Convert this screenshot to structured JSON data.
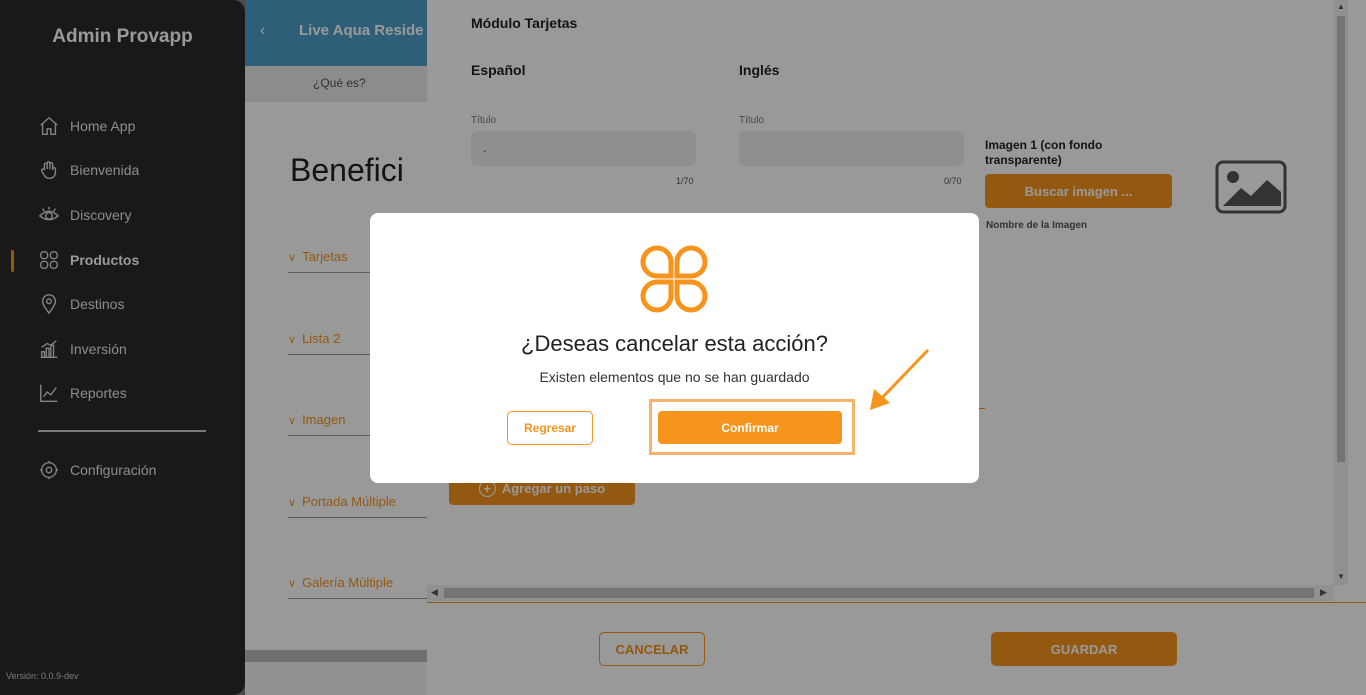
{
  "sidebar": {
    "brand": "Admin Provapp",
    "items": [
      {
        "label": "Home App",
        "icon": "home-icon"
      },
      {
        "label": "Bienvenida",
        "icon": "hand-icon"
      },
      {
        "label": "Discovery",
        "icon": "eye-icon"
      },
      {
        "label": "Productos",
        "icon": "grid-icon",
        "active": true
      },
      {
        "label": "Destinos",
        "icon": "location-pin-icon"
      },
      {
        "label": "Inversión",
        "icon": "bar-chart-icon"
      },
      {
        "label": "Reportes",
        "icon": "line-chart-icon"
      },
      {
        "label": "Configuración",
        "icon": "gear-icon"
      }
    ],
    "version": "Versión: 0.0.9-dev"
  },
  "background": {
    "topbar_title": "Live Aqua Reside",
    "subtab": "¿Qué es?",
    "heading": "Benefici",
    "accordions": [
      "Tarjetas",
      "Lista 2",
      "Imagen",
      "Portada Múltiple",
      "Galería Múltiple"
    ]
  },
  "panel": {
    "title": "Módulo Tarjetas",
    "spanish": {
      "heading": "Español",
      "field_label": "Título",
      "field_value": ".",
      "counter": "1/70"
    },
    "english": {
      "heading": "Inglés",
      "field_label": "Título",
      "field_value": "",
      "counter": "0/70"
    },
    "image": {
      "label": "Imagen 1 (con fondo transparente)",
      "search_button": "Buscar imagen ...",
      "name_label": "Nombre de la Imagen"
    },
    "add_step_button": "Agregar un paso",
    "cancel_button": "CANCELAR",
    "save_button": "GUARDAR"
  },
  "modal": {
    "title": "¿Deseas cancelar esta acción?",
    "subtitle": "Existen elementos que no se han guardado",
    "back_button": "Regresar",
    "confirm_button": "Confirmar"
  },
  "colors": {
    "accent": "#f7941d",
    "sidebar_bg": "#2a2a2a",
    "topbar": "#4f9fc9",
    "overlay": "rgba(0,0,0,0.4)"
  }
}
